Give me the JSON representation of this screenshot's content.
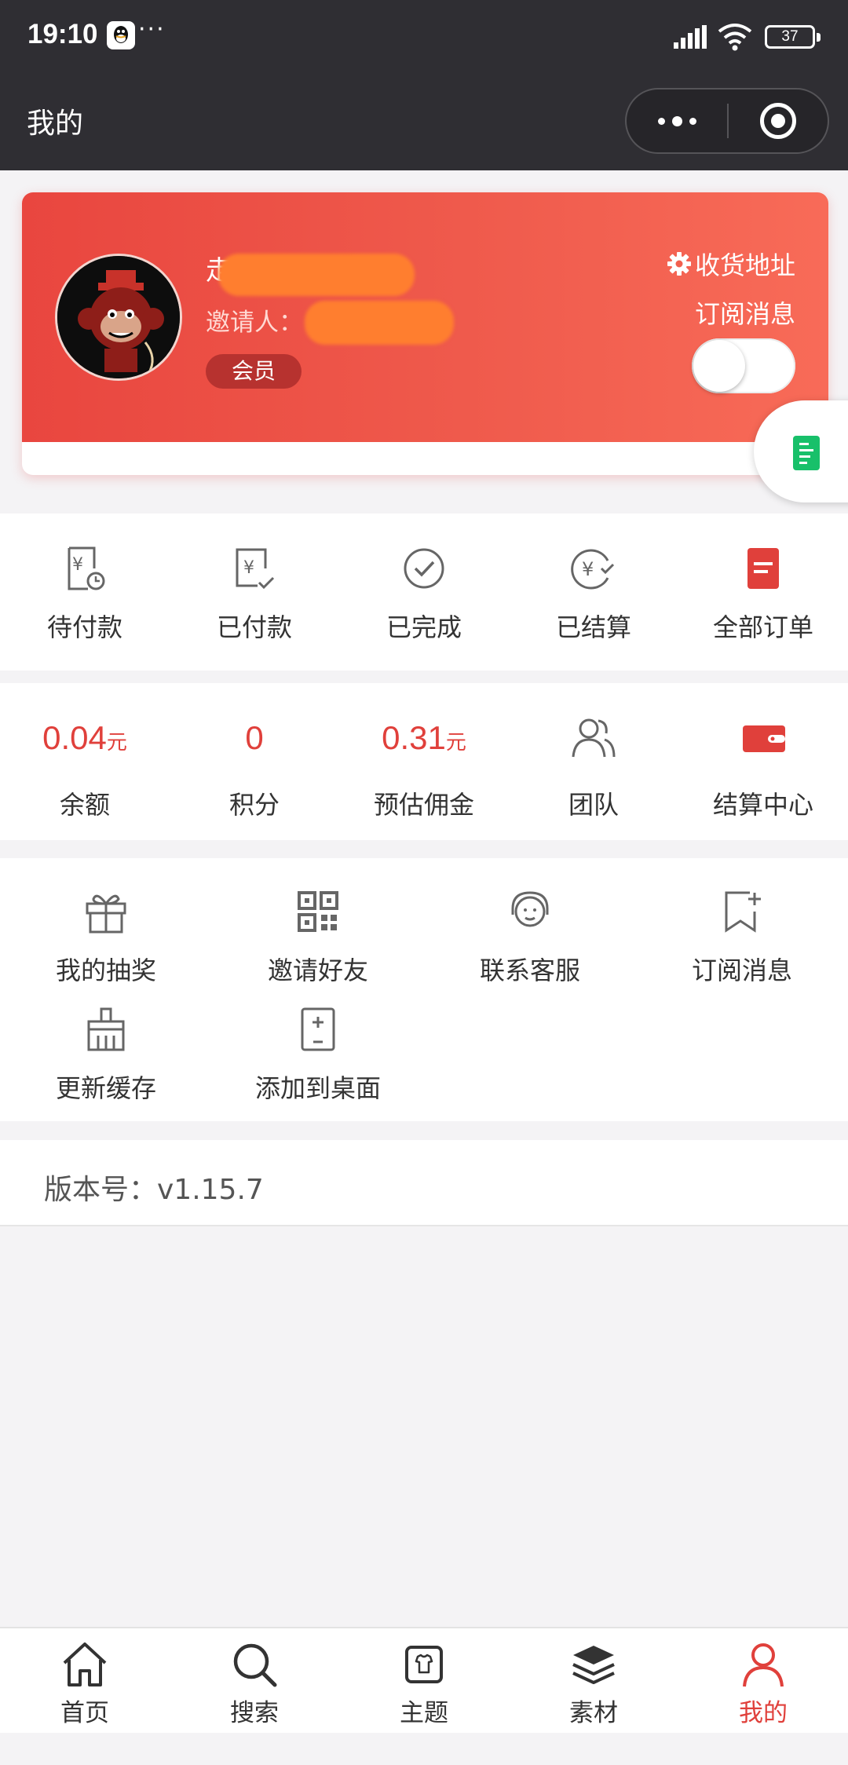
{
  "status_bar": {
    "time": "19:10",
    "battery": "37",
    "icons": [
      "qq-icon",
      "signal-icon",
      "wifi-icon",
      "battery-icon"
    ]
  },
  "title_bar": {
    "title": "我的",
    "buttons": [
      "more-icon",
      "close-target-icon"
    ]
  },
  "profile": {
    "username": "走",
    "inviter_label": "邀请人：",
    "member_badge": "会员",
    "address_link": "收货地址",
    "subscribe_label": "订阅消息",
    "subscribe_on": false
  },
  "orders": [
    {
      "label": "待付款",
      "icon": "pending-payment-icon"
    },
    {
      "label": "已付款",
      "icon": "paid-icon"
    },
    {
      "label": "已完成",
      "icon": "completed-icon"
    },
    {
      "label": "已结算",
      "icon": "settled-icon"
    },
    {
      "label": "全部订单",
      "icon": "all-orders-icon"
    }
  ],
  "stats": {
    "balance": {
      "value": "0.04",
      "unit": "元",
      "label": "余额"
    },
    "points": {
      "value": "0",
      "label": "积分"
    },
    "commission": {
      "value": "0.31",
      "unit": "元",
      "label": "预估佣金"
    },
    "team": {
      "label": "团队",
      "icon": "team-icon"
    },
    "settlement": {
      "label": "结算中心",
      "icon": "wallet-icon"
    }
  },
  "tools": [
    {
      "label": "我的抽奖",
      "icon": "gift-icon"
    },
    {
      "label": "邀请好友",
      "icon": "qrcode-icon"
    },
    {
      "label": "联系客服",
      "icon": "customer-service-icon"
    },
    {
      "label": "订阅消息",
      "icon": "bookmark-add-icon"
    },
    {
      "label": "更新缓存",
      "icon": "broom-icon"
    },
    {
      "label": "添加到桌面",
      "icon": "add-to-desktop-icon"
    }
  ],
  "version": "版本号：v1.15.7",
  "tabbar": [
    {
      "label": "首页",
      "icon": "home-icon"
    },
    {
      "label": "搜索",
      "icon": "search-icon"
    },
    {
      "label": "主题",
      "icon": "theme-icon"
    },
    {
      "label": "素材",
      "icon": "layers-icon"
    },
    {
      "label": "我的",
      "icon": "user-icon",
      "active": true
    }
  ],
  "colors": {
    "accent": "#e0403b",
    "card_gradient_start": "#e9463f",
    "card_gradient_end": "#f86b58",
    "header_bg": "#2f2e33"
  }
}
